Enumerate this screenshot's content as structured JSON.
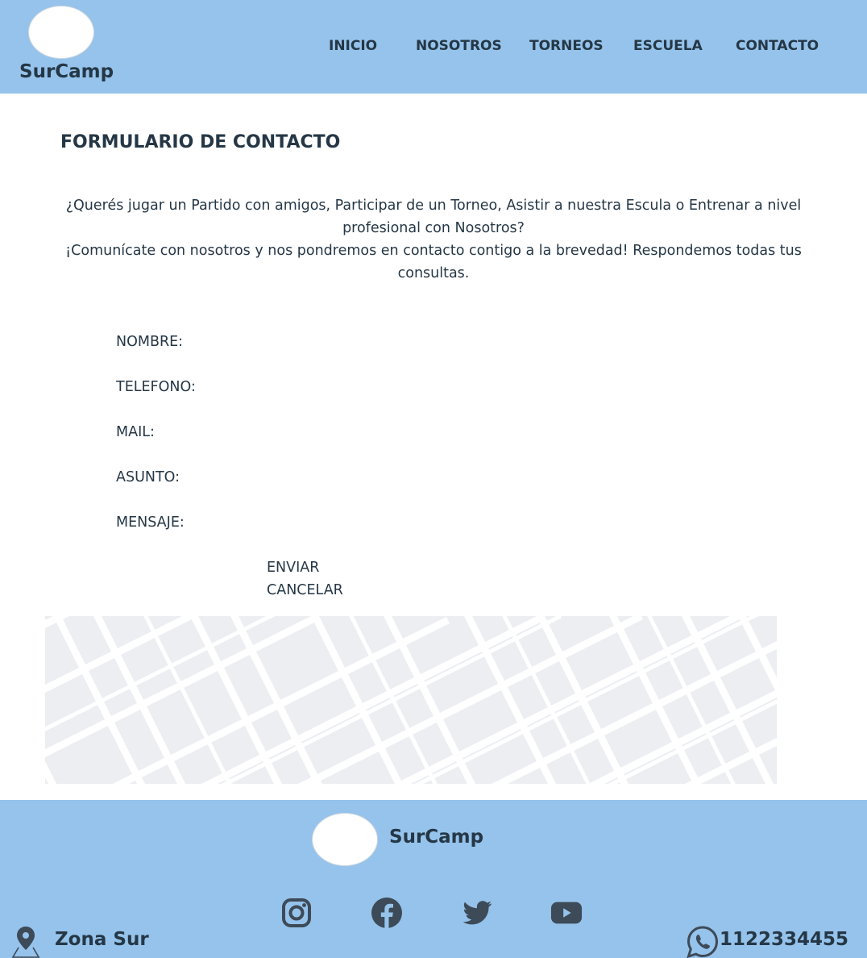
{
  "header": {
    "brand": "SurCamp",
    "nav": [
      {
        "label": "INICIO"
      },
      {
        "label": "NOSOTROS"
      },
      {
        "label": "TORNEOS"
      },
      {
        "label": "ESCUELA"
      },
      {
        "label": "CONTACTO"
      }
    ]
  },
  "main": {
    "title": "FORMULARIO DE CONTACTO",
    "intro_line1": "¿Querés jugar un Partido con amigos, Participar de un Torneo, Asistir a nuestra Escula o Entrenar a nivel profesional con Nosotros?",
    "intro_line2": "¡Comunícate con nosotros y nos pondremos en contacto contigo a la brevedad! Respondemos todas tus consultas.",
    "fields": [
      {
        "label": "NOMBRE:",
        "value": ""
      },
      {
        "label": "TELEFONO:",
        "value": ""
      },
      {
        "label": "MAIL:",
        "value": ""
      },
      {
        "label": "ASUNTO:",
        "value": ""
      },
      {
        "label": "MENSAJE:",
        "value": ""
      }
    ],
    "submit_label": "ENVIAR",
    "cancel_label": "CANCELAR"
  },
  "footer": {
    "brand": "SurCamp",
    "social": [
      "instagram-icon",
      "facebook-icon",
      "twitter-icon",
      "youtube-icon"
    ],
    "location": "Zona Sur",
    "phone": "1122334455"
  },
  "colors": {
    "header_bg": "#95c3eb",
    "text": "#253746",
    "map_bg": "#eceef2"
  }
}
